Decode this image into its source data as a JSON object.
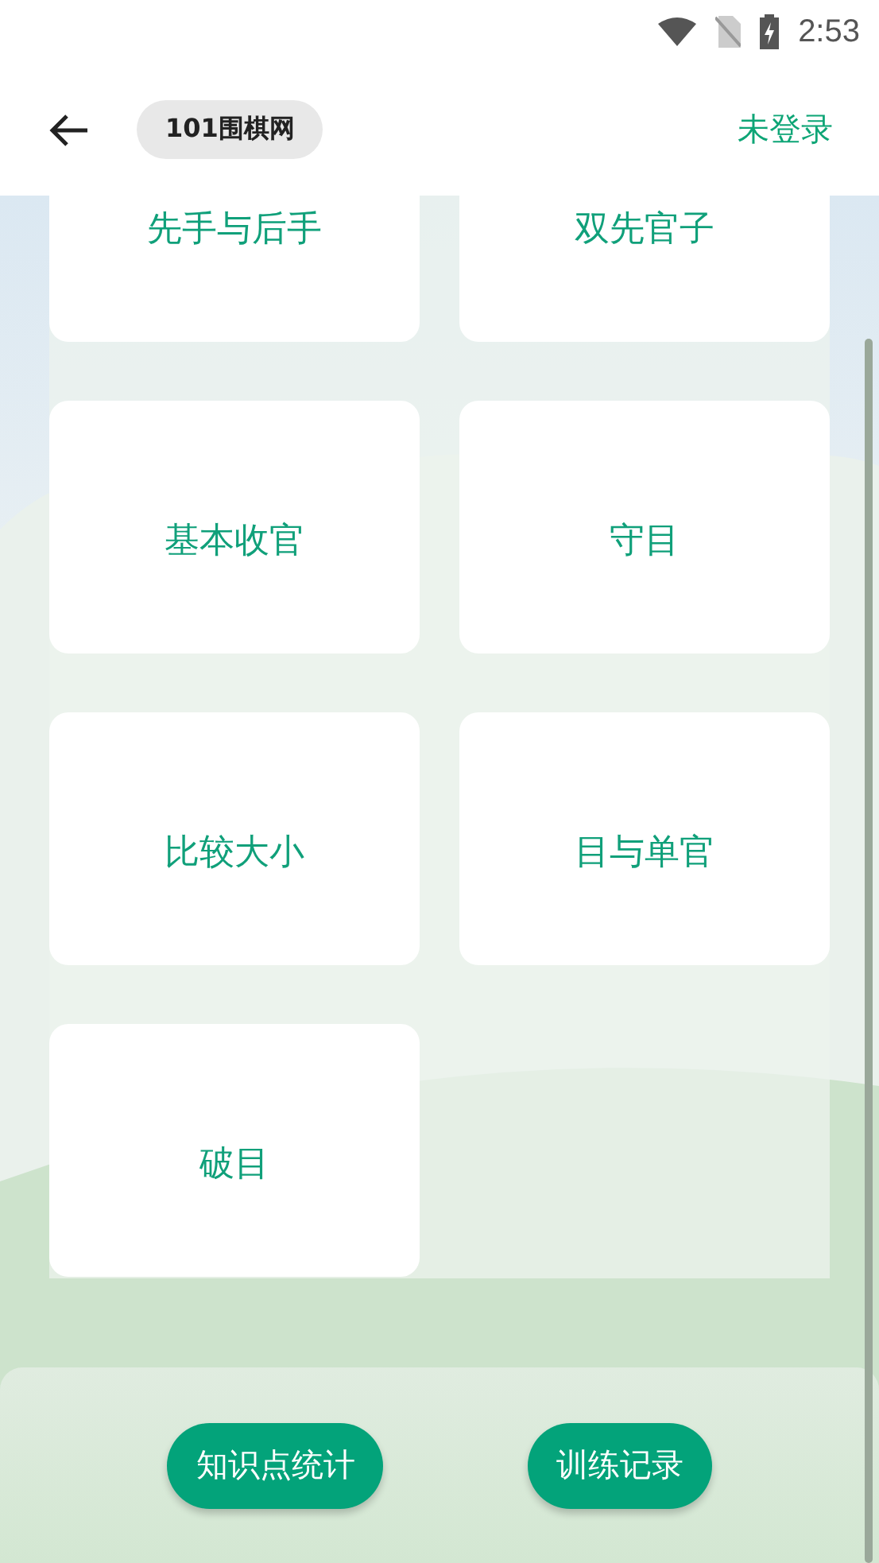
{
  "status_bar": {
    "time": "2:53"
  },
  "header": {
    "site_badge": "101围棋网",
    "login": "未登录"
  },
  "topics": [
    {
      "label": "先手与后手"
    },
    {
      "label": "双先官子"
    },
    {
      "label": "基本收官"
    },
    {
      "label": "守目"
    },
    {
      "label": "比较大小"
    },
    {
      "label": "目与单官"
    },
    {
      "label": "破目"
    }
  ],
  "buttons": [
    "知识点统计",
    "训练记录"
  ]
}
